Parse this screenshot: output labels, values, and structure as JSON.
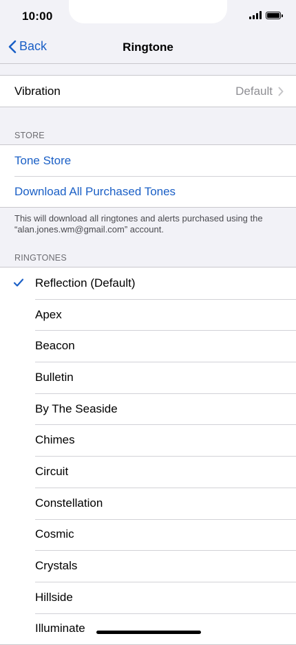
{
  "status_bar": {
    "time": "10:00"
  },
  "nav": {
    "back_label": "Back",
    "title": "Ringtone"
  },
  "vibration": {
    "label": "Vibration",
    "value": "Default"
  },
  "store": {
    "header": "STORE",
    "tone_store_label": "Tone Store",
    "download_all_label": "Download All Purchased Tones",
    "note": "This will download all ringtones and alerts purchased using the “alan.jones.wm@gmail.com” account."
  },
  "ringtones": {
    "header": "RINGTONES",
    "selected_index": 0,
    "items": [
      "Reflection (Default)",
      "Apex",
      "Beacon",
      "Bulletin",
      "By The Seaside",
      "Chimes",
      "Circuit",
      "Constellation",
      "Cosmic",
      "Crystals",
      "Hillside",
      "Illuminate"
    ]
  },
  "colors": {
    "accent": "#1a5fc6",
    "secondary_text": "#8e8e93",
    "background": "#f2f2f7"
  }
}
